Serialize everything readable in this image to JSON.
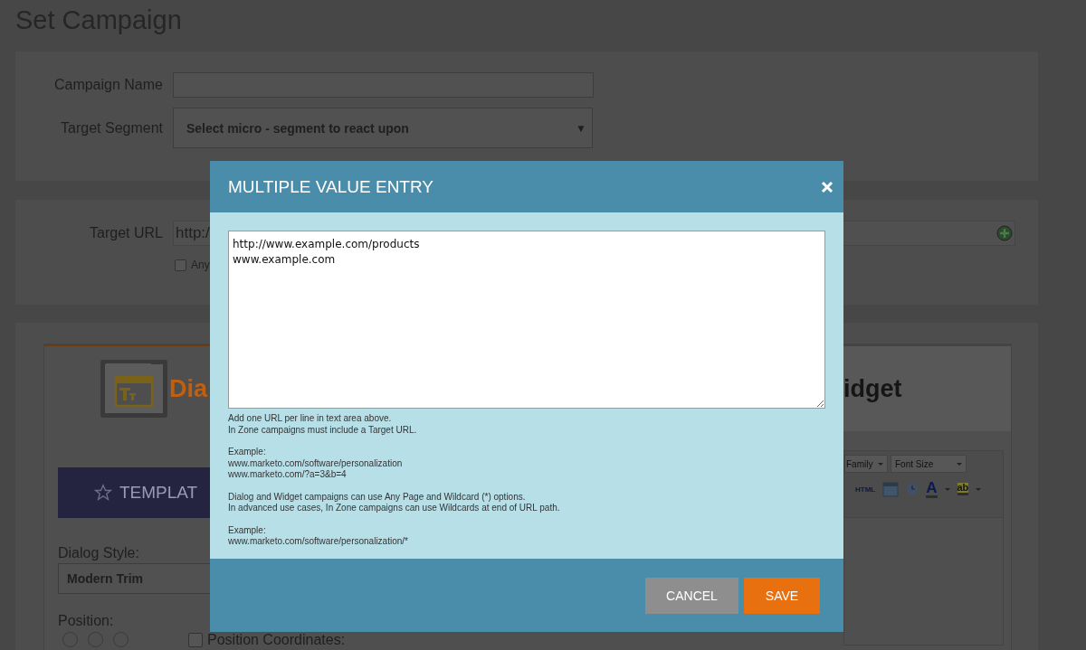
{
  "page": {
    "title": "Set Campaign"
  },
  "campaign_form": {
    "name_label": "Campaign Name",
    "segment_label": "Target Segment",
    "segment_value": "Select micro - segment to react upon",
    "segment_caret": "▼"
  },
  "target": {
    "label": "Target URL",
    "value": "http:/",
    "any_checkbox": {
      "label": "Any",
      "checked": false
    }
  },
  "design": {
    "tabs": [
      {
        "label": "Dia",
        "selected": true
      },
      {
        "label": "idget",
        "selected": false
      }
    ],
    "template_button": "TEMPLAT",
    "dialog_style_label": "Dialog Style:",
    "dialog_style_value": "Modern Trim",
    "position_label": "Position:",
    "position_options": [
      {
        "selected": false
      },
      {
        "selected": false
      },
      {
        "selected": false
      }
    ],
    "coordinates_checkbox": {
      "label": "Position Coordinates:",
      "checked": false
    },
    "editor_toolbar": {
      "font_family": "Family",
      "font_size": "Font Size",
      "html": "HTML",
      "text_color": "A",
      "highlight": "ab"
    }
  },
  "modal": {
    "title": "MULTIPLE VALUE ENTRY",
    "value": "http://www.example.com/products\nwww.example.com",
    "help": [
      [
        "Add one URL per line in text area above.",
        "In Zone campaigns must include a Target URL."
      ],
      [
        "Example:",
        "www.marketo.com/software/personalization",
        "www.marketo.com/?a=3&b=4"
      ],
      [
        "Dialog and Widget campaigns can use Any Page and Wildcard (*) options.",
        "In advanced use cases, In Zone campaigns can use Wildcards at end of URL path."
      ],
      [
        "Example:",
        "www.marketo.com/software/personalization/*"
      ]
    ],
    "buttons": [
      {
        "label": "CANCEL",
        "kind": "secondary"
      },
      {
        "label": "SAVE",
        "kind": "primary"
      }
    ]
  }
}
